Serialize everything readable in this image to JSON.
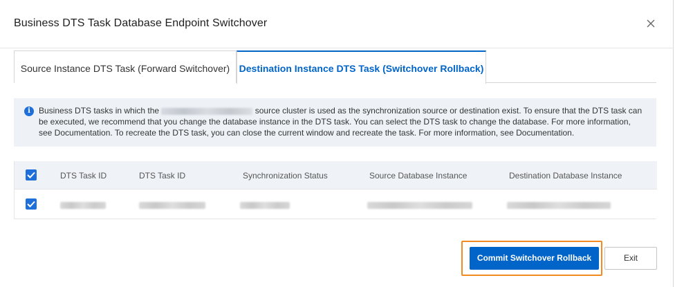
{
  "dialog": {
    "title": "Business DTS Task Database Endpoint Switchover",
    "close_icon": "close-icon"
  },
  "tabs": [
    {
      "label": "Source Instance DTS Task (Forward Switchover)",
      "active": false
    },
    {
      "label": "Destination Instance DTS Task (Switchover Rollback)",
      "active": true
    }
  ],
  "notice": {
    "icon": "info-icon",
    "text_before": "Business DTS tasks in which the ",
    "text_after": " source cluster is used as the synchronization source or destination exist. To ensure that the DTS task can be executed, we recommend that you change the database instance in the DTS task. You can select the DTS task to change the database. For more information, see Documentation. To recreate the DTS task, you can close the current window and recreate the task. For more information, see Documentation."
  },
  "table": {
    "columns": [
      "DTS Task ID",
      "DTS Task ID",
      "Synchronization Status",
      "Source Database Instance",
      "Destination Database Instance"
    ],
    "header_checked": true,
    "rows": [
      {
        "checked": true
      }
    ]
  },
  "footer": {
    "commit_label": "Commit Switchover Rollback",
    "exit_label": "Exit"
  },
  "colors": {
    "accent": "#0064c8",
    "highlight": "#f28a22",
    "notice_bg": "#eef2f7"
  }
}
